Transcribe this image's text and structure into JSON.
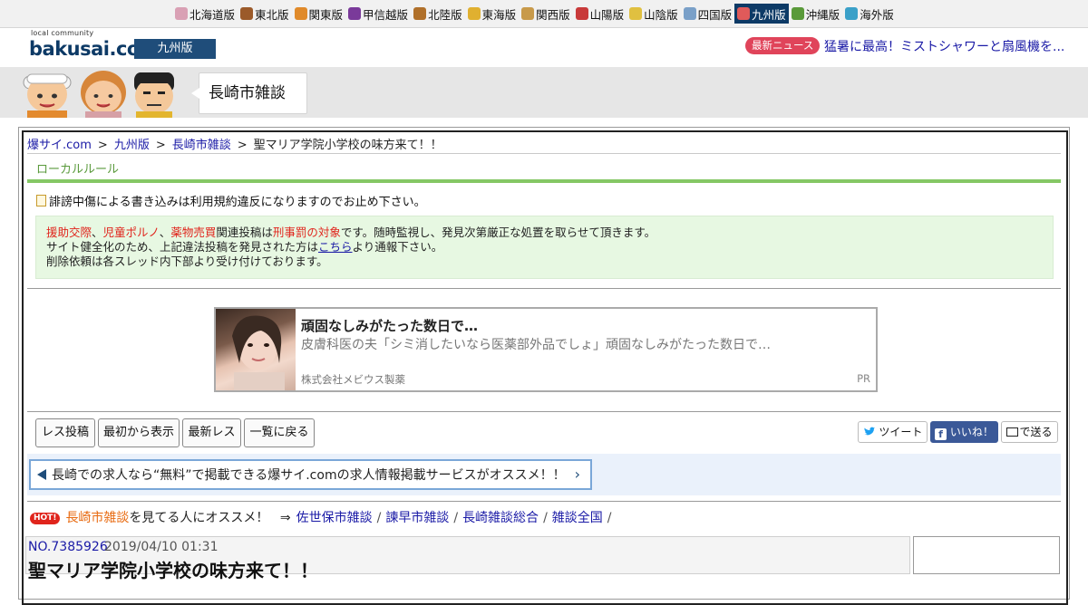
{
  "regions": [
    {
      "label": "北海道版",
      "color": "#d9a0b4"
    },
    {
      "label": "東北版",
      "color": "#9b5a2a"
    },
    {
      "label": "関東版",
      "color": "#e08a2a"
    },
    {
      "label": "甲信越版",
      "color": "#7a3a9a"
    },
    {
      "label": "北陸版",
      "color": "#b0702a"
    },
    {
      "label": "東海版",
      "color": "#e0b030"
    },
    {
      "label": "関西版",
      "color": "#c89a4a"
    },
    {
      "label": "山陽版",
      "color": "#c83a3a"
    },
    {
      "label": "山陰版",
      "color": "#e0c040"
    },
    {
      "label": "四国版",
      "color": "#7aa0c8"
    },
    {
      "label": "九州版",
      "color": "#e05a5a",
      "active": true
    },
    {
      "label": "沖縄版",
      "color": "#5a9a3a"
    },
    {
      "label": "海外版",
      "color": "#3aa0c8"
    }
  ],
  "header": {
    "logo_small": "local community",
    "logo": "bakusai.com",
    "edition": "九州版",
    "news_badge": "最新ニュース",
    "news_text": "猛暑に最高！ミストシャワーと扇風機を..."
  },
  "banner": {
    "forum_name": "長崎市雑談"
  },
  "breadcrumb": [
    {
      "label": "爆サイ.com",
      "link": true
    },
    {
      "label": "九州版",
      "link": true
    },
    {
      "label": "長崎市雑談",
      "link": true
    },
    {
      "label": "聖マリア学院小学校の味方来て！！",
      "link": false
    }
  ],
  "rules": {
    "title": "ローカルルール",
    "notice": "誹謗中傷による書き込みは利用規約違反になりますのでお止め下さい。",
    "red1": "援助交際",
    "comma1": "、",
    "red2": "児童ポルノ",
    "comma2": "、",
    "red3": "薬物売買",
    "text1": "関連投稿は",
    "red4": "刑事罰の対象",
    "text2": "です。随時監視し、発見次第厳正な処置を取らせて頂きます。",
    "line2_pre": "サイト健全化のため、上記違法投稿を発見された方は",
    "line2_link": "こちら",
    "line2_post": "より通報下さい。",
    "line3": "削除依頼は各スレッド内下部より受け付けております。"
  },
  "ad": {
    "title": "頑固なしみがたった数日で…",
    "description": "皮膚科医の夫「シミ消したいなら医薬部外品でしょ」頑固なしみがたった数日で…",
    "sponsor": "株式会社メビウス製薬",
    "pr": "PR"
  },
  "actions": {
    "post_reply": "レス投稿",
    "show_from_start": "最初から表示",
    "latest_replies": "最新レス",
    "back_to_list": "一覧に戻る",
    "tweet": "ツイート",
    "like": "いいね！",
    "send": "で送る"
  },
  "promo": {
    "text": "長崎での求人なら“無料”で掲載できる爆サイ.comの求人情報掲載サービスがオススメ！！",
    "arrow": "›"
  },
  "recommend": {
    "hot": "HOT!",
    "forum": "長崎市雑談",
    "text": "を見てる人にオススメ！",
    "arrow": "⇒",
    "links": [
      "佐世保市雑談",
      "諫早市雑談",
      "長崎雑談総合",
      "雑談全国"
    ]
  },
  "post": {
    "number": "NO.7385926",
    "date": "2019/04/10 01:31",
    "title": "聖マリア学院小学校の味方来て！！"
  }
}
